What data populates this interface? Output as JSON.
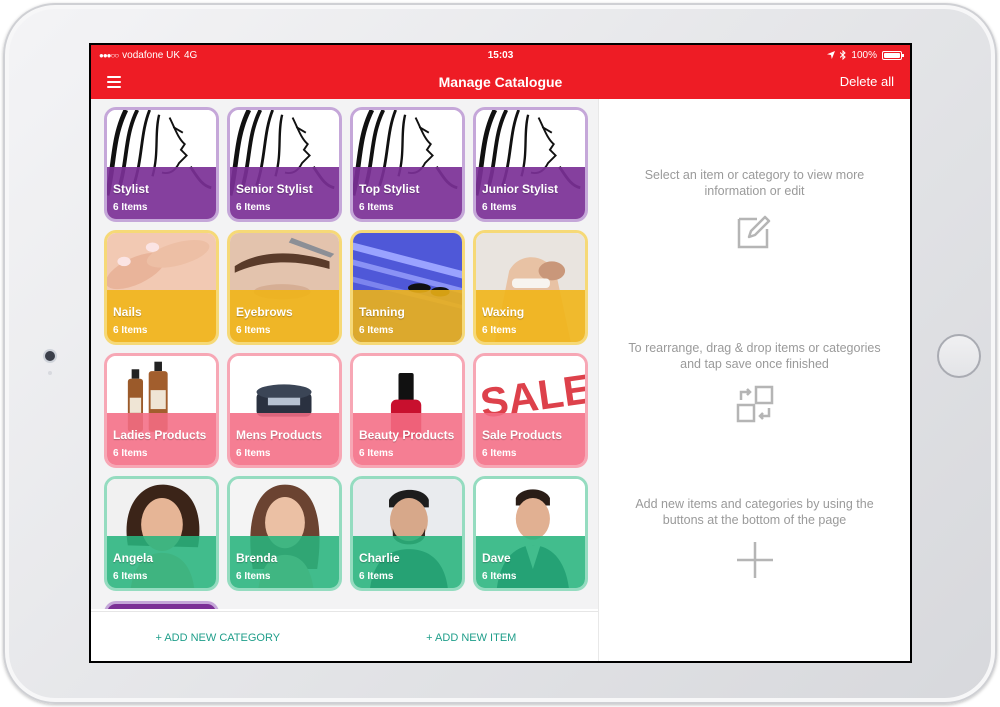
{
  "status_bar": {
    "signal": "●●●○○",
    "carrier": "vodafone UK",
    "network": "4G",
    "time": "15:03",
    "battery": "100%"
  },
  "nav": {
    "title": "Manage Catalogue",
    "delete_all": "Delete all"
  },
  "tiles": [
    {
      "name": "Stylist",
      "count": "6 Items",
      "image": "woman-hair-illustration"
    },
    {
      "name": "Senior Stylist",
      "count": "6 Items",
      "image": "woman-hair-illustration"
    },
    {
      "name": "Top Stylist",
      "count": "6 Items",
      "image": "woman-hair-illustration"
    },
    {
      "name": "Junior Stylist",
      "count": "6 Items",
      "image": "woman-hair-illustration"
    },
    {
      "name": "Nails",
      "count": "6 Items",
      "image": "nails-photo"
    },
    {
      "name": "Eyebrows",
      "count": "6 Items",
      "image": "eyebrow-photo"
    },
    {
      "name": "Tanning",
      "count": "6 Items",
      "image": "tanning-bed-photo"
    },
    {
      "name": "Waxing",
      "count": "6 Items",
      "image": "waxing-photo"
    },
    {
      "name": "Ladies Products",
      "count": "6 Items",
      "image": "bottles-photo"
    },
    {
      "name": "Mens Products",
      "count": "6 Items",
      "image": "wax-tin-photo"
    },
    {
      "name": "Beauty Products",
      "count": "6 Items",
      "image": "nail-polish-photo"
    },
    {
      "name": "Sale Products",
      "count": "6 Items",
      "image": "sale-stamp-photo"
    },
    {
      "name": "Angela",
      "count": "6 Items",
      "image": "woman-portrait"
    },
    {
      "name": "Brenda",
      "count": "6 Items",
      "image": "woman-portrait"
    },
    {
      "name": "Charlie",
      "count": "6 Items",
      "image": "man-portrait"
    },
    {
      "name": "Dave",
      "count": "6 Items",
      "image": "man-portrait"
    }
  ],
  "bottom_bar": {
    "add_category": "+ ADD NEW CATEGORY",
    "add_item": "+ ADD NEW ITEM"
  },
  "info": {
    "select_text": "Select an item or category to view more information or edit",
    "rearrange_text": "To rearrange, drag & drop items or categories and tap save once finished",
    "add_text": "Add new items and categories by using the buttons at the bottom of the page"
  },
  "colors": {
    "brand_red": "#ee1c25",
    "stylist_purple": "#7b3096",
    "service_yellow": "#f0b414",
    "product_pink": "#f46c84",
    "staff_green": "#28b47d",
    "link_teal": "#1f9e8a"
  }
}
